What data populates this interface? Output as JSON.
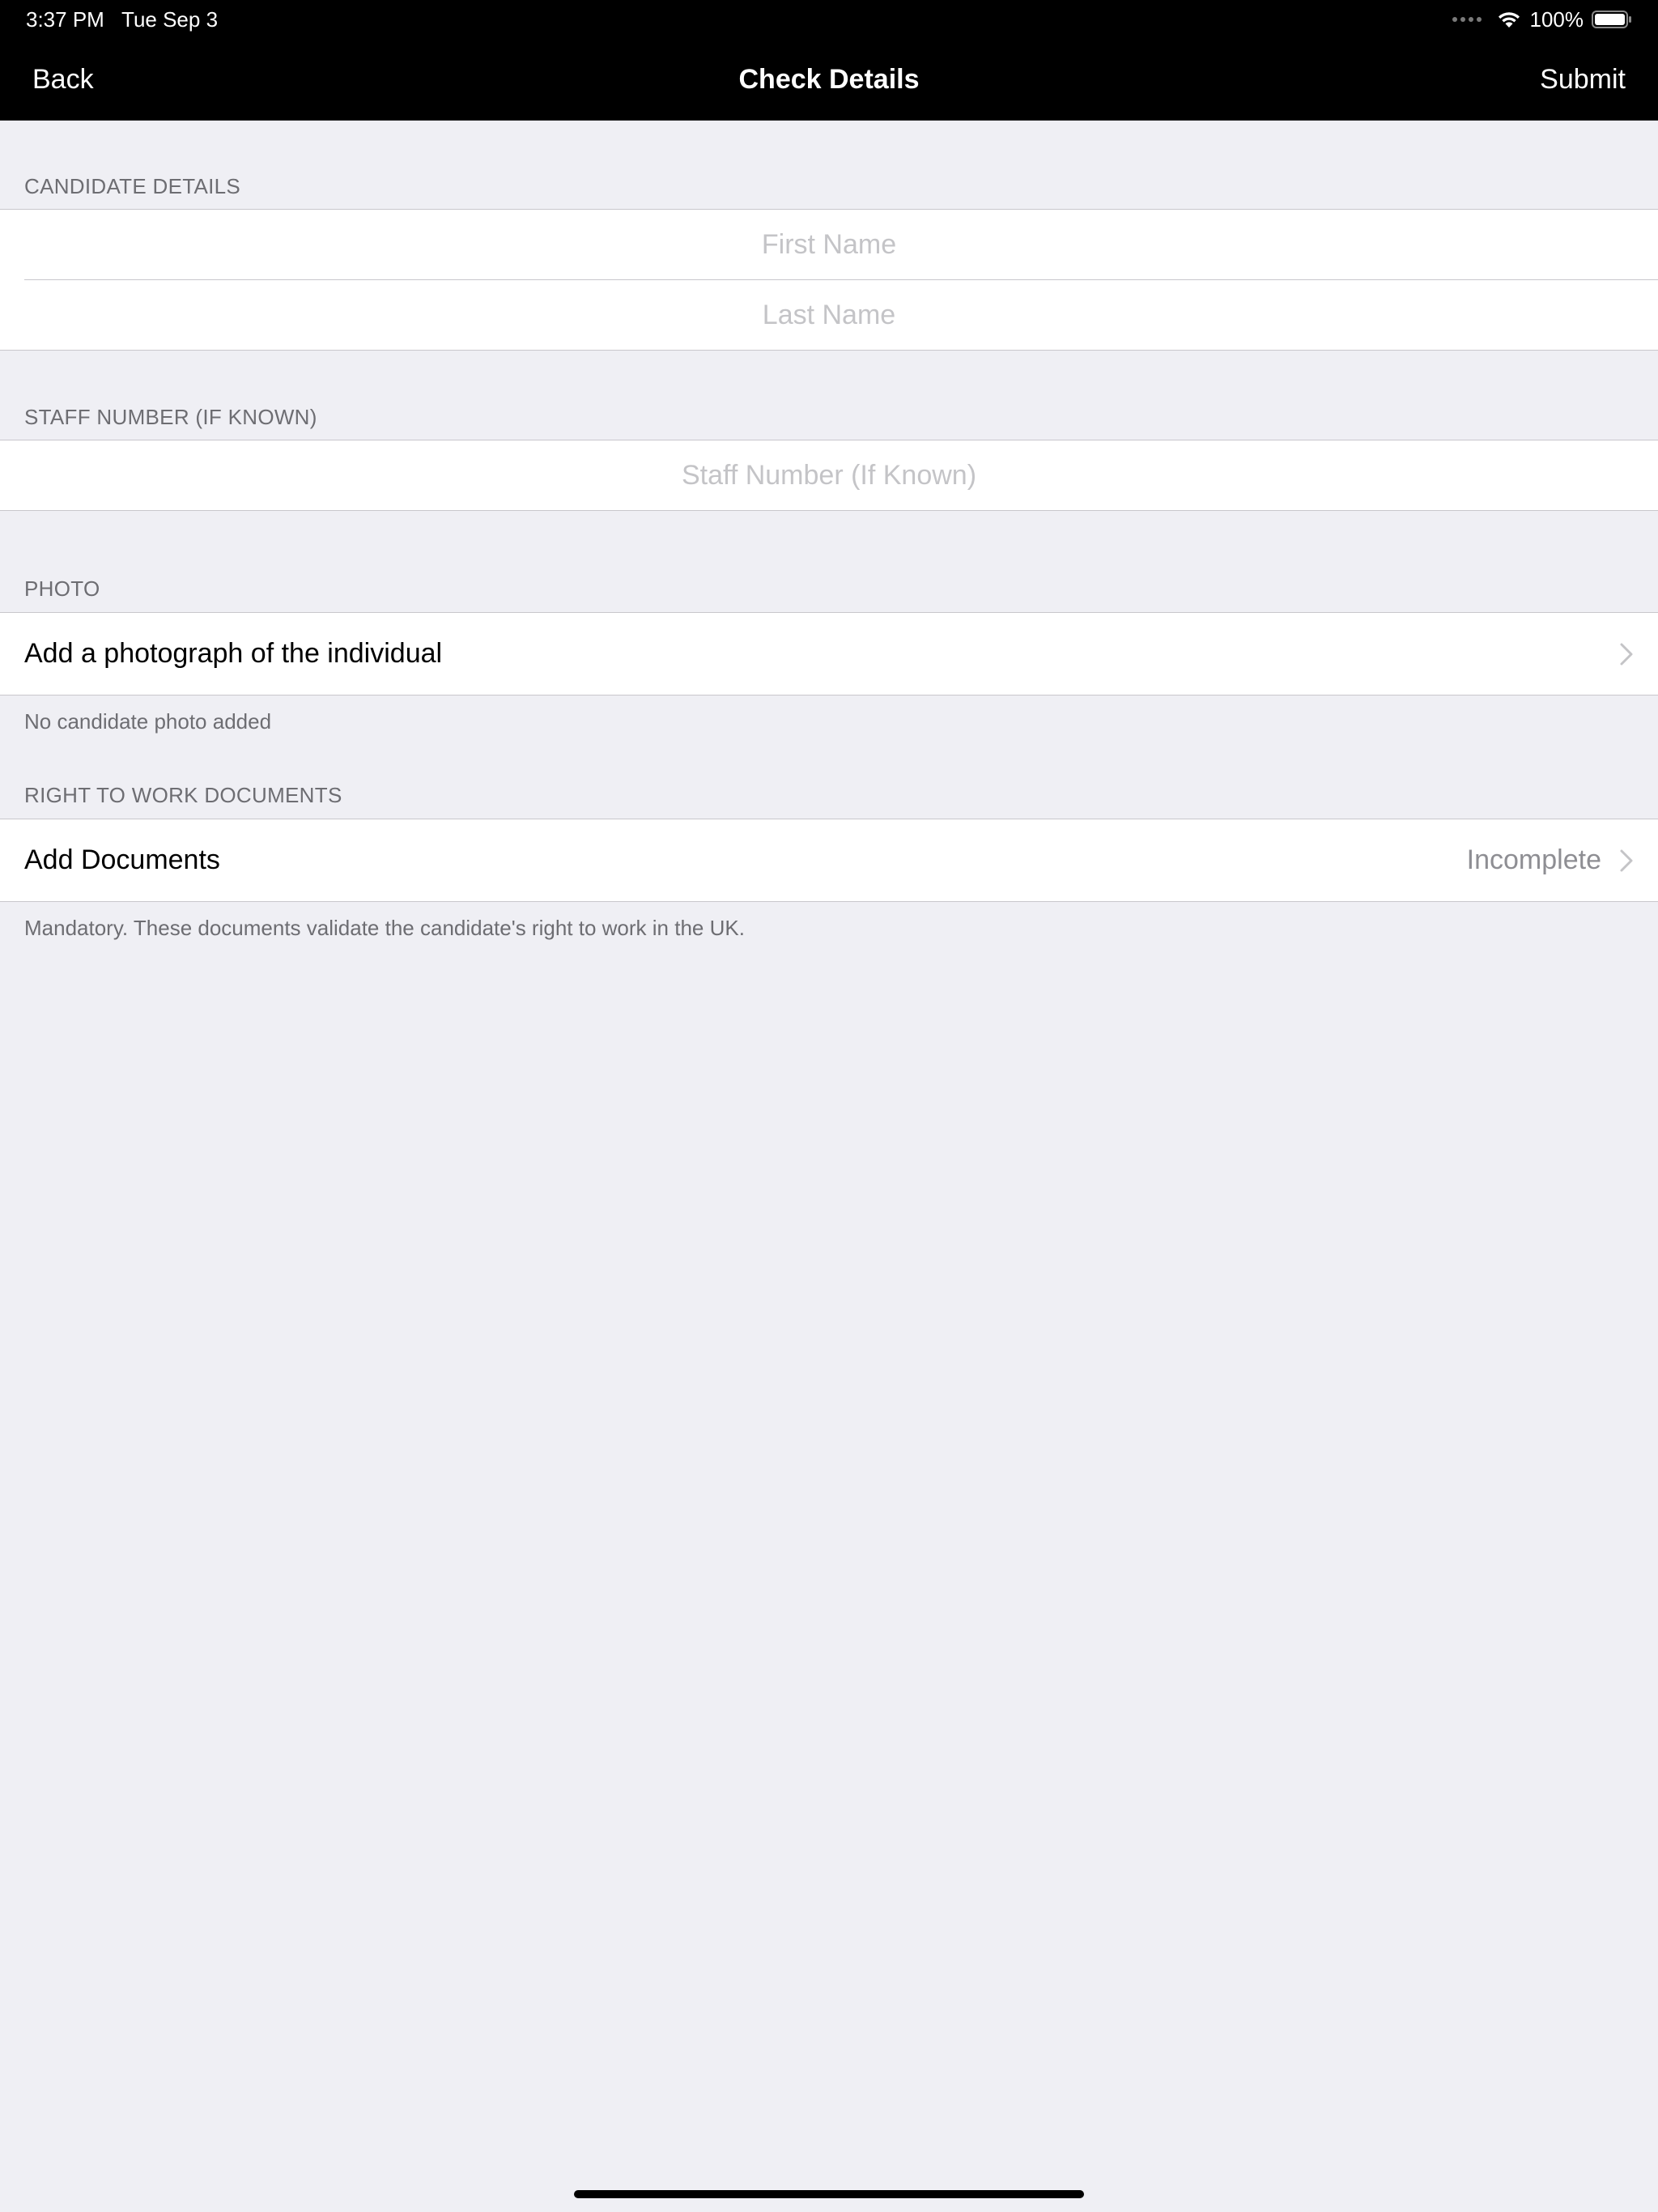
{
  "status_bar": {
    "time": "3:37 PM",
    "date": "Tue Sep 3",
    "battery": "100%",
    "wifi_icon": "wifi-icon",
    "battery_icon": "battery-icon"
  },
  "nav": {
    "back_label": "Back",
    "title": "Check Details",
    "submit_label": "Submit"
  },
  "candidate": {
    "header": "CANDIDATE DETAILS",
    "first_name": {
      "value": "",
      "placeholder": "First Name"
    },
    "last_name": {
      "value": "",
      "placeholder": "Last Name"
    }
  },
  "staff": {
    "header": "STAFF NUMBER (IF KNOWN)",
    "field": {
      "value": "",
      "placeholder": "Staff Number (If Known)"
    }
  },
  "photo": {
    "header": "PHOTO",
    "row_label": "Add a photograph of the individual",
    "footer": "No candidate photo added"
  },
  "documents": {
    "header": "RIGHT TO WORK DOCUMENTS",
    "row_label": "Add Documents",
    "row_status": "Incomplete",
    "footer": "Mandatory. These documents validate the candidate's right to work in the UK."
  },
  "colors": {
    "background": "#efeff4",
    "nav_bar": "#000000",
    "section_header": "#6d6d72",
    "placeholder": "#c4c4c7",
    "secondary_value": "#8e8e93",
    "separator": "#c8c7cc"
  }
}
